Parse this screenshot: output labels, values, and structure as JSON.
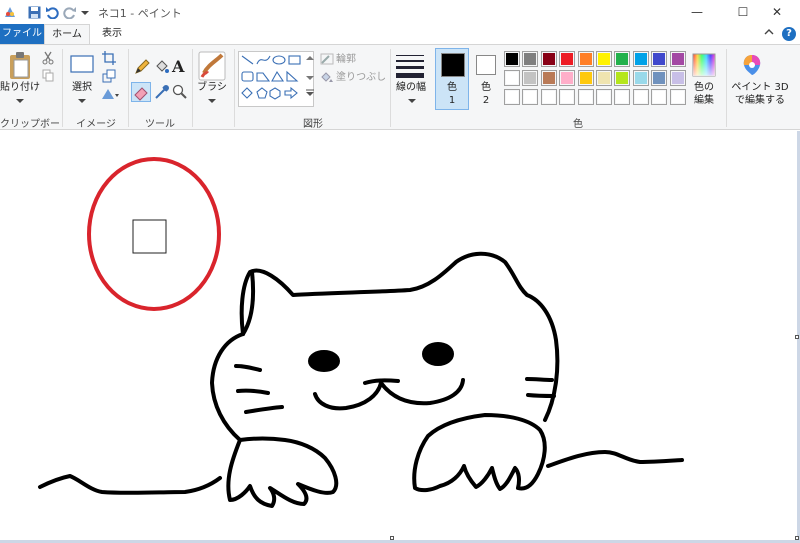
{
  "window": {
    "title": "ネコ1 - ペイント",
    "minimize_glyph": "—",
    "maximize_glyph": "☐",
    "close_glyph": "✕"
  },
  "tabs": [
    {
      "label": "ファイル"
    },
    {
      "label": "ホーム"
    },
    {
      "label": "表示"
    }
  ],
  "ribbon": {
    "clipboard": {
      "paste_label": "貼り付け",
      "group_label": "クリップボード"
    },
    "image": {
      "select_label": "選択",
      "group_label": "イメージ"
    },
    "tools": {
      "group_label": "ツール"
    },
    "brushes": {
      "label": "ブラシ"
    },
    "shapes": {
      "outline_label": "輪郭",
      "fill_label": "塗りつぶし",
      "group_label": "図形"
    },
    "size": {
      "label": "線の幅"
    },
    "colors": {
      "color1_label": "色\n1",
      "color2_label": "色\n2",
      "edit_label": "色の\n編集",
      "group_label": "色",
      "color1_value": "#000000",
      "color2_value": "#ffffff",
      "palette_row1": [
        "#000000",
        "#7f7f7f",
        "#880015",
        "#ed1c24",
        "#ff7f27",
        "#fff200",
        "#22b14c",
        "#00a2e8",
        "#3f48cc",
        "#a349a4"
      ],
      "palette_row2": [
        "#ffffff",
        "#c3c3c3",
        "#b97a57",
        "#ffaec9",
        "#ffc90e",
        "#efe4b0",
        "#b5e61d",
        "#99d9ea",
        "#7092be",
        "#c8bfe7"
      ]
    },
    "paint3d": {
      "label": "ペイント 3D\nで編集する"
    }
  },
  "drawing": {
    "circle_color": "#d9242c",
    "stroke_color": "#000000"
  }
}
